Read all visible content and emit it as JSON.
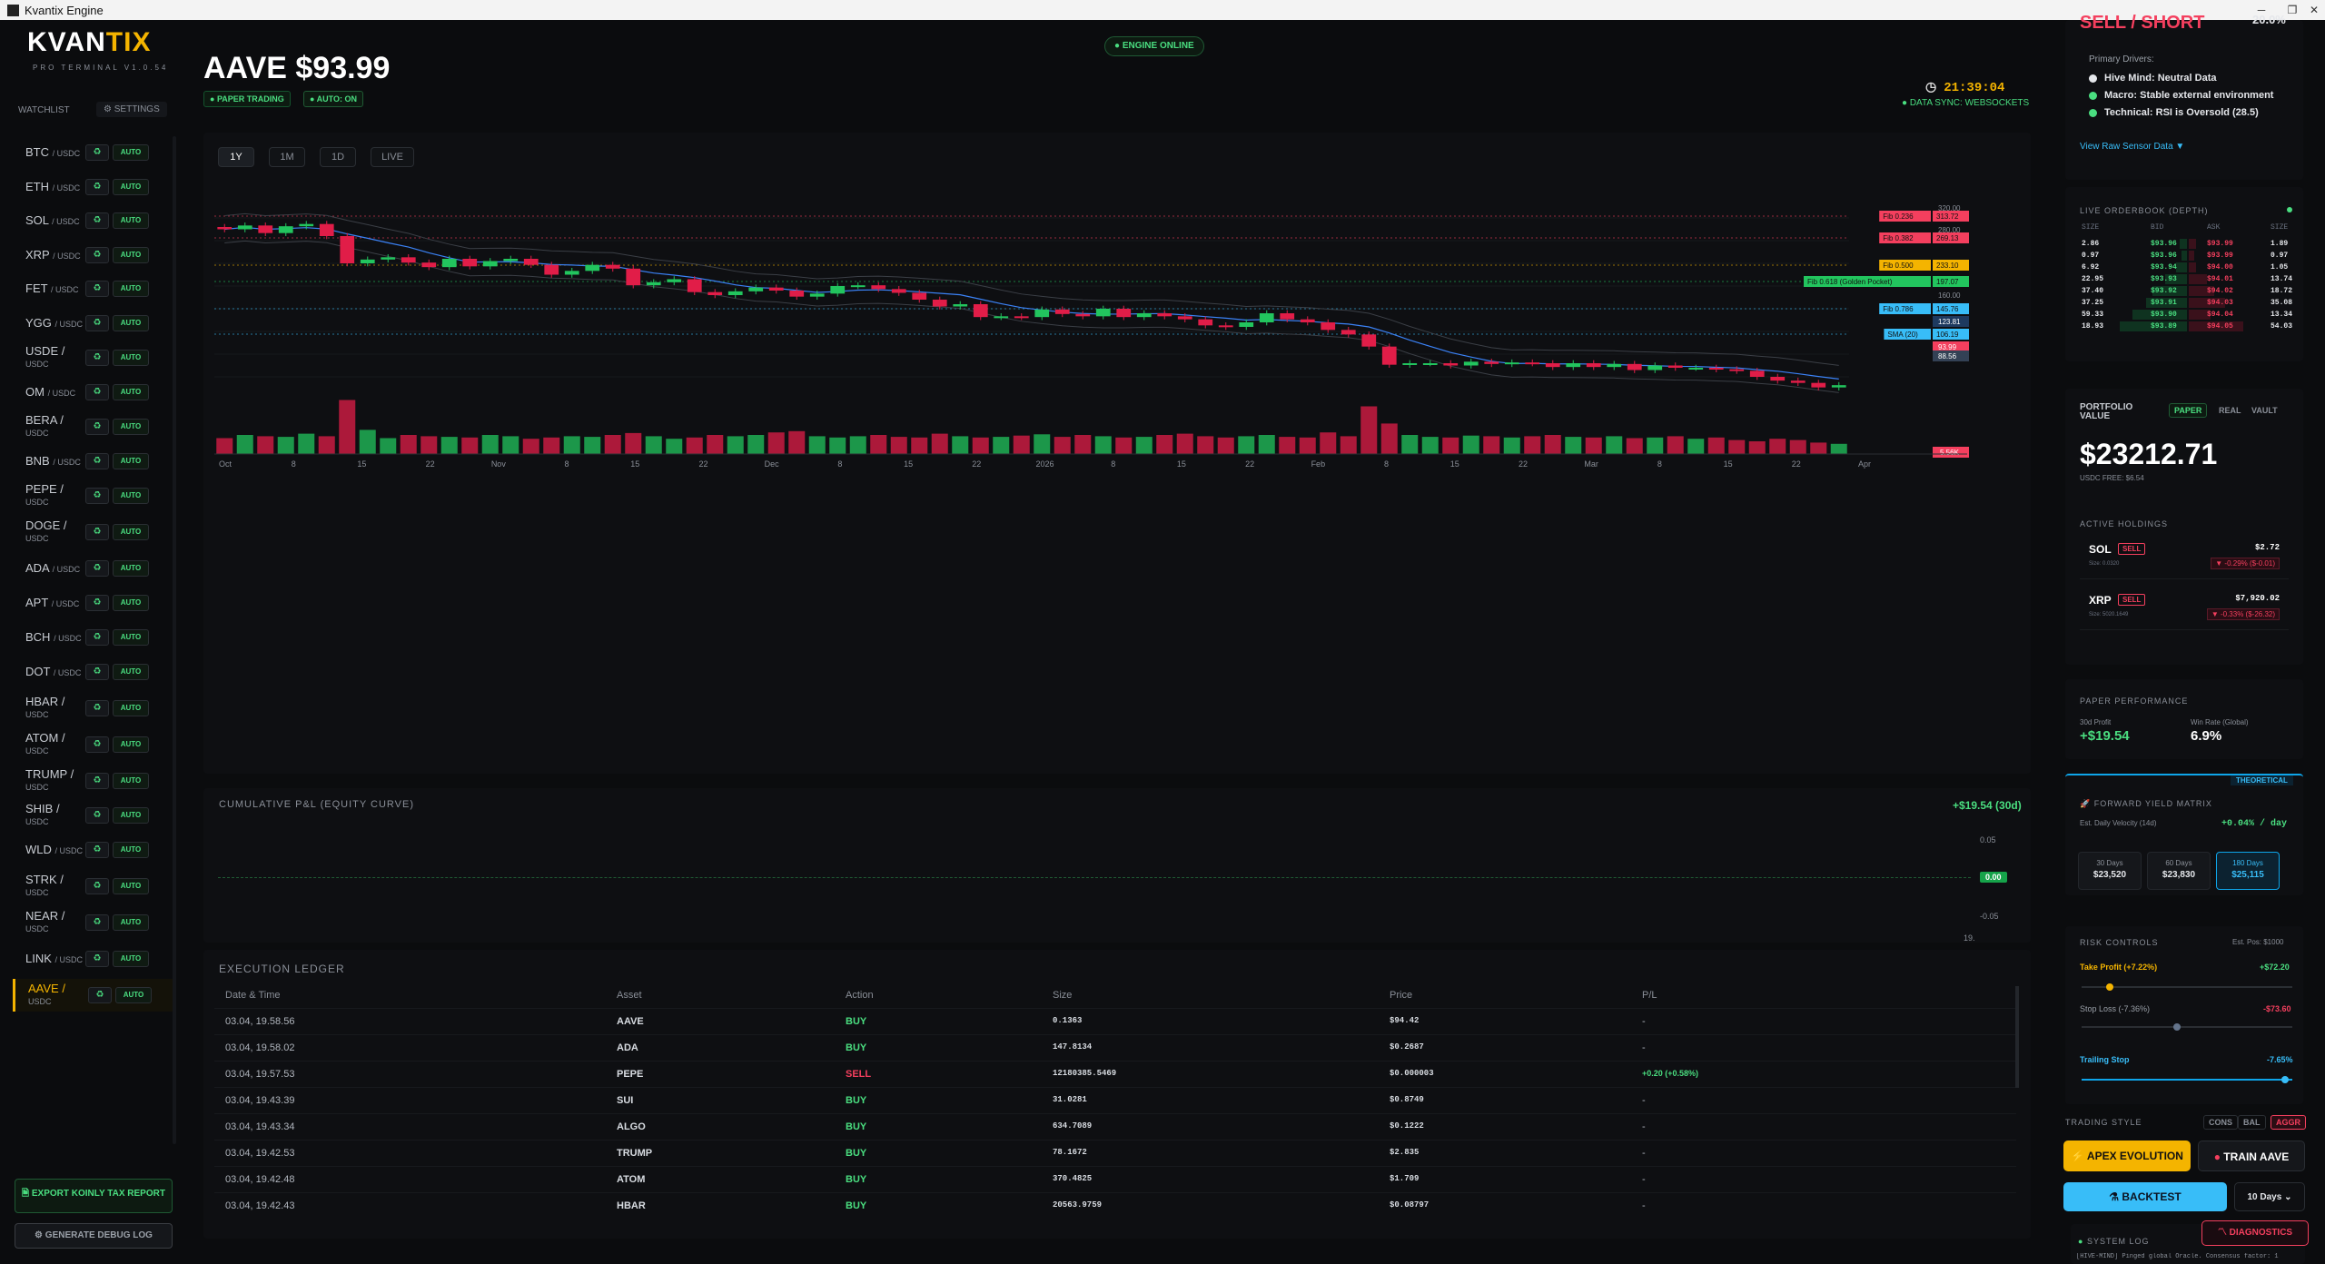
{
  "window": {
    "title": "Kvantix Engine"
  },
  "brand": {
    "name_a": "KVAN",
    "name_b": "TIX",
    "subtitle": "PRO TERMINAL V1.0.54"
  },
  "watchlist": {
    "label": "WATCHLIST",
    "settings_label": "SETTINGS",
    "auto_label": "AUTO",
    "items": [
      {
        "sym": "BTC",
        "pair": "/ USDC"
      },
      {
        "sym": "ETH",
        "pair": "/ USDC"
      },
      {
        "sym": "SOL",
        "pair": "/ USDC"
      },
      {
        "sym": "XRP",
        "pair": "/ USDC"
      },
      {
        "sym": "FET",
        "pair": "/ USDC"
      },
      {
        "sym": "YGG",
        "pair": "/ USDC"
      },
      {
        "sym": "USDE /",
        "pair": "USDC"
      },
      {
        "sym": "OM",
        "pair": "/ USDC"
      },
      {
        "sym": "BERA /",
        "pair": "USDC"
      },
      {
        "sym": "BNB",
        "pair": "/ USDC"
      },
      {
        "sym": "PEPE /",
        "pair": "USDC"
      },
      {
        "sym": "DOGE /",
        "pair": "USDC"
      },
      {
        "sym": "ADA",
        "pair": "/ USDC"
      },
      {
        "sym": "APT",
        "pair": "/ USDC"
      },
      {
        "sym": "BCH",
        "pair": "/ USDC"
      },
      {
        "sym": "DOT",
        "pair": "/ USDC"
      },
      {
        "sym": "HBAR /",
        "pair": "USDC"
      },
      {
        "sym": "ATOM /",
        "pair": "USDC"
      },
      {
        "sym": "TRUMP /",
        "pair": "USDC"
      },
      {
        "sym": "SHIB /",
        "pair": "USDC"
      },
      {
        "sym": "WLD",
        "pair": "/ USDC"
      },
      {
        "sym": "STRK /",
        "pair": "USDC"
      },
      {
        "sym": "NEAR /",
        "pair": "USDC"
      },
      {
        "sym": "LINK",
        "pair": "/ USDC"
      },
      {
        "sym": "AAVE /",
        "pair": "USDC"
      }
    ],
    "active_index": 24
  },
  "sidebar_buttons": {
    "export": "EXPORT KOINLY TAX REPORT",
    "debug": "GENERATE DEBUG LOG"
  },
  "header": {
    "asset_title": "AAVE $93.99",
    "badge_paper": "PAPER TRADING",
    "badge_auto": "AUTO: ON",
    "engine_status": "ENGINE ONLINE",
    "clock": "21:39:04",
    "sync": "DATA SYNC: WEBSOCKETS"
  },
  "timeframes": [
    "1Y",
    "1M",
    "1D",
    "LIVE"
  ],
  "chart_data": {
    "type": "candlestick",
    "x_ticks": [
      "Oct",
      "8",
      "15",
      "22",
      "Nov",
      "8",
      "15",
      "22",
      "Dec",
      "8",
      "15",
      "22",
      "2026",
      "8",
      "15",
      "22",
      "Feb",
      "8",
      "15",
      "22",
      "Mar",
      "8",
      "15",
      "22",
      "Apr"
    ],
    "close": [
      345,
      350,
      340,
      349,
      352,
      336,
      300,
      305,
      308,
      301,
      295,
      306,
      296,
      303,
      306,
      298,
      285,
      290,
      298,
      293,
      271,
      275,
      279,
      262,
      258,
      263,
      268,
      264,
      256,
      260,
      270,
      271,
      266,
      261,
      252,
      243,
      246,
      229,
      230,
      229,
      239,
      233,
      230,
      240,
      229,
      234,
      230,
      226,
      218,
      216,
      222,
      234,
      226,
      222,
      212,
      206,
      190,
      166,
      168,
      168,
      165,
      170,
      167,
      169,
      168,
      163,
      168,
      163,
      167,
      159,
      165,
      162,
      162,
      160,
      158,
      150,
      145,
      142,
      136,
      139
    ],
    "volume": [
      25,
      30,
      28,
      27,
      32,
      28,
      85,
      38,
      25,
      30,
      28,
      27,
      26,
      30,
      28,
      24,
      26,
      28,
      27,
      30,
      33,
      28,
      24,
      26,
      30,
      28,
      30,
      34,
      36,
      28,
      26,
      28,
      30,
      27,
      26,
      32,
      28,
      26,
      27,
      29,
      31,
      27,
      30,
      28,
      26,
      27,
      30,
      32,
      28,
      26,
      28,
      30,
      27,
      26,
      34,
      28,
      75,
      48,
      30,
      27,
      26,
      29,
      28,
      26,
      28,
      30,
      27,
      26,
      28,
      25,
      26,
      28,
      24,
      26,
      22,
      20,
      24,
      22,
      18,
      16
    ],
    "levels": [
      {
        "label": "Fib 0.236",
        "value": "313.72",
        "kind": "sell"
      },
      {
        "label": "Fib 0.382",
        "value": "269.13",
        "kind": "sell"
      },
      {
        "label": "Fib 0.500",
        "value": "233.10",
        "kind": "warn"
      },
      {
        "label": "Fib 0.618 (Golden Pocket)",
        "value": "197.07",
        "kind": "buy"
      },
      {
        "label": "Fib 0.786",
        "value": "145.76",
        "kind": "info"
      },
      {
        "label": "SMA (20)",
        "value": "106.19",
        "kind": "info"
      }
    ],
    "price_labels": [
      "123.81",
      "93.99",
      "88.56"
    ],
    "axis_ticks": [
      "320.00",
      "280.00",
      "160.00"
    ],
    "volume_label": "5.56K"
  },
  "pnl": {
    "title": "CUMULATIVE P&L (EQUITY CURVE)",
    "value": "+$19.54 (30d)",
    "y_top": "0.05",
    "y_zero": "0.00",
    "y_bottom": "-0.05",
    "x_label": "19."
  },
  "ledger": {
    "title": "EXECUTION LEDGER",
    "headers": [
      "Date & Time",
      "Asset",
      "Action",
      "Size",
      "Price",
      "P/L"
    ],
    "rows": [
      [
        "03.04, 19.58.56",
        "AAVE",
        "BUY",
        "0.1363",
        "$94.42",
        "-"
      ],
      [
        "03.04, 19.58.02",
        "ADA",
        "BUY",
        "147.8134",
        "$0.2687",
        "-"
      ],
      [
        "03.04, 19.57.53",
        "PEPE",
        "SELL",
        "12180385.5469",
        "$0.000003",
        "+0.20 (+0.58%)"
      ],
      [
        "03.04, 19.43.39",
        "SUI",
        "BUY",
        "31.0281",
        "$0.8749",
        "-"
      ],
      [
        "03.04, 19.43.34",
        "ALGO",
        "BUY",
        "634.7089",
        "$0.1222",
        "-"
      ],
      [
        "03.04, 19.42.53",
        "TRUMP",
        "BUY",
        "78.1672",
        "$2.835",
        "-"
      ],
      [
        "03.04, 19.42.48",
        "ATOM",
        "BUY",
        "370.4825",
        "$1.709",
        "-"
      ],
      [
        "03.04, 19.42.43",
        "HBAR",
        "BUY",
        "20563.9759",
        "$0.08797",
        "-"
      ]
    ]
  },
  "signal": {
    "signal_label": "SELL / SHORT",
    "confidence": "20.0%",
    "drivers_title": "Primary Drivers:",
    "drivers": [
      {
        "label": "Hive Mind:",
        "text": "Neutral Data",
        "color": "#e5e7eb"
      },
      {
        "label": "Macro:",
        "text": "Stable external environment",
        "color": "#4ade80"
      },
      {
        "label": "Technical:",
        "text": "RSI is Oversold (28.5)",
        "color": "#4ade80"
      }
    ],
    "sensor_link": "View Raw Sensor Data ▼"
  },
  "orderbook": {
    "title": "LIVE ORDERBOOK (DEPTH)",
    "headers": [
      "SIZE",
      "BID",
      "ASK",
      "SIZE"
    ],
    "rows": [
      [
        "2.86",
        "$93.96",
        "$93.99",
        "1.89"
      ],
      [
        "0.97",
        "$93.96",
        "$93.99",
        "0.97"
      ],
      [
        "6.92",
        "$93.94",
        "$94.00",
        "1.05"
      ],
      [
        "22.95",
        "$93.93",
        "$94.01",
        "13.74"
      ],
      [
        "37.40",
        "$93.92",
        "$94.02",
        "18.72"
      ],
      [
        "37.25",
        "$93.91",
        "$94.03",
        "35.08"
      ],
      [
        "59.33",
        "$93.90",
        "$94.04",
        "13.34"
      ],
      [
        "18.93",
        "$93.89",
        "$94.05",
        "54.03"
      ]
    ]
  },
  "portfolio": {
    "title_a": "PORTFOLIO",
    "title_b": "VALUE",
    "modes": [
      "PAPER",
      "REAL",
      "VAULT"
    ],
    "value": "$23212.71",
    "usdc_free": "USDC FREE: $6.54",
    "holdings_title": "ACTIVE HOLDINGS",
    "holdings": [
      {
        "sym": "SOL",
        "tag": "SELL",
        "size": "Size: 0.0320",
        "value": "$2.72",
        "change": "▼ -0.29% ($-0.01)"
      },
      {
        "sym": "XRP",
        "tag": "SELL",
        "size": "Size: 5020.1649",
        "value": "$7,920.02",
        "change": "▼ -0.33% ($-26.32)"
      }
    ]
  },
  "performance": {
    "title": "PAPER PERFORMANCE",
    "profit_label": "30d Profit",
    "profit": "+$19.54",
    "winrate_label": "Win Rate (Global)",
    "winrate": "6.9%"
  },
  "forward": {
    "badge": "THEORETICAL",
    "title": "FORWARD YIELD MATRIX",
    "velocity_label": "Est. Daily Velocity (14d)",
    "velocity": "+0.04% / day",
    "cards": [
      {
        "label": "30 Days",
        "value": "$23,520"
      },
      {
        "label": "60 Days",
        "value": "$23,830"
      },
      {
        "label": "180 Days",
        "value": "$25,115"
      }
    ]
  },
  "risk": {
    "title": "RISK CONTROLS",
    "est_pos": "Est. Pos: $1000",
    "tp_label": "Take Profit (+7.22%)",
    "tp_value": "+$72.20",
    "sl_label": "Stop Loss (-7.36%)",
    "sl_value": "-$73.60",
    "ts_label": "Trailing Stop",
    "ts_value": "-7.65%",
    "tp_level": 0.12,
    "sl_level": 0.45,
    "ts_level": 0.98
  },
  "style": {
    "label": "TRADING STYLE",
    "options": [
      "CONS",
      "BAL",
      "AGGR"
    ],
    "evolution": "APEX EVOLUTION",
    "train": "TRAIN AAVE",
    "backtest": "BACKTEST",
    "days": "10 Days",
    "diagnostics": "DIAGNOSTICS"
  },
  "syslog": {
    "title": "SYSTEM LOG",
    "line": "[HIVE-MIND] Pinged global Oracle. Consensus factor: 1"
  },
  "colors": {
    "accent": "#f4b400",
    "buy": "#4ade80",
    "sell": "#f43f5e",
    "info": "#38bdf8"
  }
}
